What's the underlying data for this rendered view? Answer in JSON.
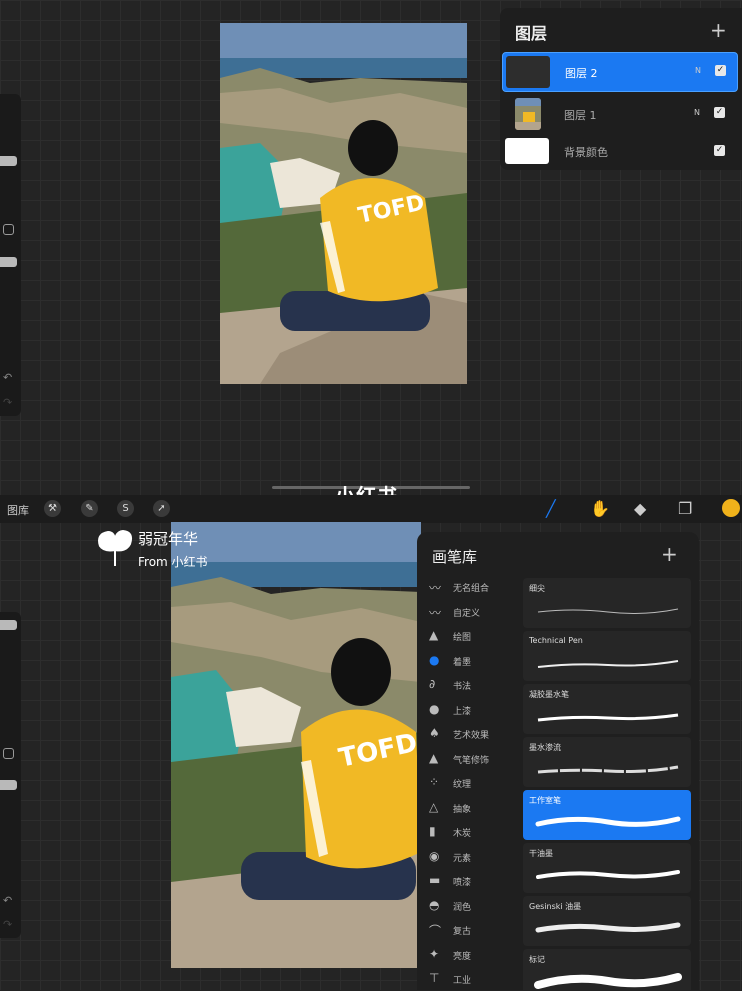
{
  "layers_panel": {
    "title": "图层",
    "add_label": "+",
    "layers": [
      {
        "name": "图层 2",
        "mode": "N",
        "active": true
      },
      {
        "name": "图层 1",
        "mode": "N",
        "active": false
      },
      {
        "name": "背景颜色",
        "mode": "",
        "active": false
      }
    ]
  },
  "toolbar": {
    "gallery_label": "图库",
    "color_hex": "#f0b21b"
  },
  "platform_logo": "小红书",
  "watermark": {
    "line1": "弱冠年华",
    "line2": "From 小红书"
  },
  "brush_library": {
    "title": "画笔库",
    "add_label": "+",
    "categories": [
      {
        "label": "无名组合",
        "icon": "stroke-icon"
      },
      {
        "label": "自定义",
        "icon": "feather-icon"
      },
      {
        "label": "绘图",
        "icon": "pencil-tip-icon"
      },
      {
        "label": "着墨",
        "icon": "ink-drop-icon",
        "selected": true
      },
      {
        "label": "书法",
        "icon": "calligraphy-icon"
      },
      {
        "label": "上漆",
        "icon": "paint-drop-icon"
      },
      {
        "label": "艺术效果",
        "icon": "art-icon"
      },
      {
        "label": "气笔修饰",
        "icon": "airbrush-icon"
      },
      {
        "label": "纹理",
        "icon": "texture-icon"
      },
      {
        "label": "抽象",
        "icon": "triangle-icon"
      },
      {
        "label": "木炭",
        "icon": "charcoal-icon"
      },
      {
        "label": "元素",
        "icon": "globe-icon"
      },
      {
        "label": "喷漆",
        "icon": "spraycan-icon"
      },
      {
        "label": "润色",
        "icon": "touchup-icon"
      },
      {
        "label": "复古",
        "icon": "retro-icon"
      },
      {
        "label": "亮度",
        "icon": "sparkle-icon"
      },
      {
        "label": "工业",
        "icon": "industry-icon"
      }
    ],
    "brushes": [
      {
        "name": "细尖",
        "selected": false
      },
      {
        "name": "Technical Pen",
        "selected": false
      },
      {
        "name": "凝胶墨水笔",
        "selected": false
      },
      {
        "name": "墨水渗流",
        "selected": false
      },
      {
        "name": "工作室笔",
        "selected": true
      },
      {
        "name": "干油墨",
        "selected": false
      },
      {
        "name": "Gesinski 油墨",
        "selected": false
      },
      {
        "name": "标记",
        "selected": false
      }
    ]
  }
}
